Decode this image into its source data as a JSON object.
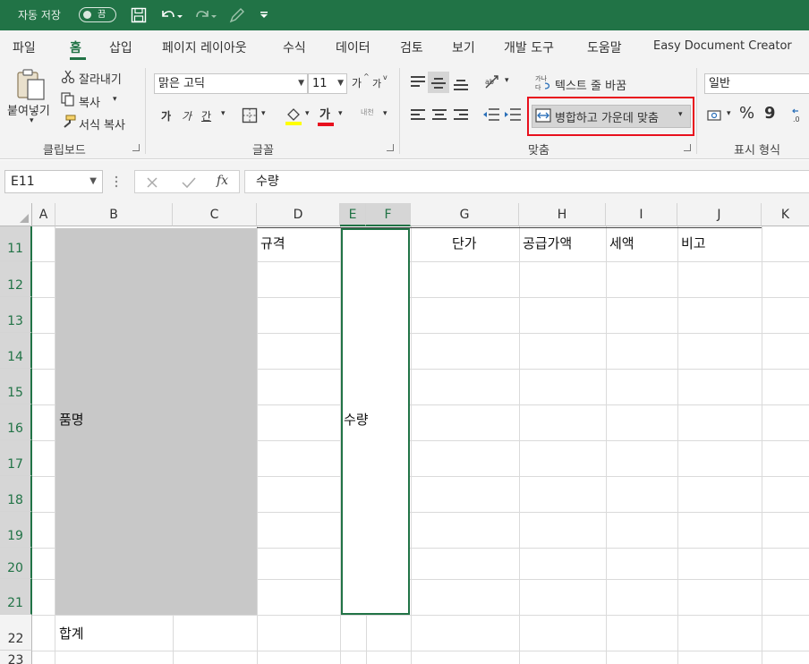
{
  "titlebar": {
    "autosave_label": "자동 저장",
    "autosave_state": "끔"
  },
  "menu": {
    "tabs": [
      "파일",
      "홈",
      "삽입",
      "페이지 레이아웃",
      "수식",
      "데이터",
      "검토",
      "보기",
      "개발 도구",
      "도움말",
      "Easy Document Creator"
    ],
    "active_tab": "홈"
  },
  "ribbon": {
    "clipboard": {
      "paste": "붙여넣기",
      "cut": "잘라내기",
      "copy": "복사",
      "format_painter": "서식 복사",
      "group_label": "클립보드"
    },
    "font": {
      "font_name": "맑은 고딕",
      "font_size": "11",
      "grow": "가",
      "shrink": "가",
      "bold": "가",
      "italic": "가",
      "underline": "간",
      "font_color": "가",
      "phonetic": "내천",
      "group_label": "글꼴"
    },
    "alignment": {
      "wrap_text": "텍스트 줄 바꿈",
      "merge_center": "병합하고 가운데 맞춤",
      "group_label": "맞춤"
    },
    "number": {
      "format": "일반",
      "percent": "%",
      "comma": "9",
      "group_label": "표시 형식"
    }
  },
  "formula_bar": {
    "name_box": "E11",
    "fx": "fx",
    "formula": "수량"
  },
  "sheet": {
    "columns": [
      "A",
      "B",
      "C",
      "D",
      "E",
      "F",
      "G",
      "H",
      "I",
      "J",
      "K"
    ],
    "selected_columns": [
      "E",
      "F"
    ],
    "rows": [
      "11",
      "12",
      "13",
      "14",
      "15",
      "16",
      "17",
      "18",
      "19",
      "20",
      "21",
      "22",
      "23"
    ],
    "selected_rows": [
      "11",
      "12",
      "13",
      "14",
      "15",
      "16",
      "17",
      "18",
      "19",
      "20",
      "21"
    ],
    "cells": {
      "B11_merged": "품명",
      "D11": "규격",
      "E11_merged": "수량",
      "G11": "단가",
      "H11": "공급가액",
      "I11": "세액",
      "J11": "비고",
      "B22": "합계"
    }
  },
  "colors": {
    "accent": "#217346",
    "highlight": "#e8101d",
    "merged_fill": "#c8c8c8"
  }
}
